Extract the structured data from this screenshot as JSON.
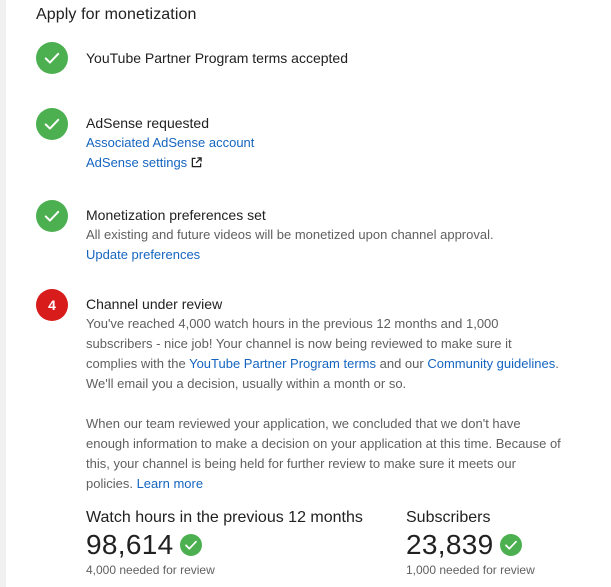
{
  "page": {
    "title": "Apply for monetization"
  },
  "steps": [
    {
      "status": "done",
      "title": "YouTube Partner Program terms accepted"
    },
    {
      "status": "done",
      "title": "AdSense requested",
      "links": [
        "Associated AdSense account",
        "AdSense settings"
      ]
    },
    {
      "status": "done",
      "title": "Monetization preferences set",
      "description": "All existing and future videos will be monetized upon channel approval.",
      "link": "Update preferences"
    },
    {
      "status": "pending",
      "number": "4",
      "title": "Channel under review",
      "para1": {
        "text_a": "You've reached 4,000 watch hours in the previous 12 months and 1,000 subscribers - nice job! Your channel is now being reviewed to make sure it complies with the ",
        "link_a": "YouTube Partner Program terms",
        "text_b": " and our ",
        "link_b": "Community guidelines",
        "text_c": ". We'll email you a decision, usually within a month or so."
      },
      "para2": {
        "text": "When our team reviewed your application, we concluded that we don't have enough information to make a decision on your application at this time. Because of this, your channel is being held for further review to make sure it meets our policies. ",
        "link": "Learn more"
      }
    }
  ],
  "stats": {
    "watch_hours": {
      "label": "Watch hours in the previous 12 months",
      "value": "98,614",
      "sub": "4,000 needed for review"
    },
    "subscribers": {
      "label": "Subscribers",
      "value": "23,839",
      "sub": "1,000 needed for review"
    }
  },
  "colors": {
    "done_badge": "#4caf50",
    "pending_badge": "#d81b1b",
    "link": "#1565c0"
  },
  "icons": {
    "done": "checkmark-icon",
    "external": "external-link-icon"
  }
}
